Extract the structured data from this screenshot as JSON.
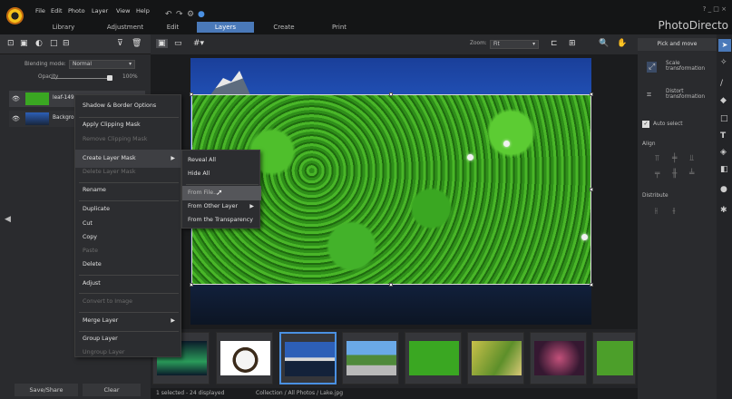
{
  "menubar": {
    "items": [
      "File",
      "Edit",
      "Photo",
      "Layer",
      "View",
      "Help"
    ],
    "undo_icons": [
      "↶",
      "↷",
      "⚙",
      "●"
    ],
    "window_controls": "? _ □ ×"
  },
  "tabs": [
    {
      "label": "Library"
    },
    {
      "label": "Adjustment"
    },
    {
      "label": "Edit"
    },
    {
      "label": "Layers"
    },
    {
      "label": "Create"
    },
    {
      "label": "Print"
    }
  ],
  "brand": "PhotoDirecto",
  "left_panel": {
    "blending_label": "Blending mode:",
    "blending_value": "Normal",
    "opacity_label": "Opacity",
    "opacity_value": "100%",
    "opacity": 1.0,
    "layers": [
      {
        "name": "leaf-14999"
      },
      {
        "name": "Background"
      }
    ],
    "save_share": "Save/Share",
    "clear": "Clear"
  },
  "canvas_toolbar": {
    "zoom_label": "Zoom:",
    "zoom_value": "Fit"
  },
  "context_menu": {
    "items": [
      {
        "label": "Shadow & Border Options",
        "enabled": true
      },
      {
        "label": "Apply Clipping Mask",
        "enabled": true
      },
      {
        "label": "Remove Clipping Mask",
        "enabled": false
      },
      {
        "label": "Create Layer Mask",
        "enabled": true,
        "submenu": true
      },
      {
        "label": "Delete Layer Mask",
        "enabled": false
      },
      {
        "label": "Rename",
        "enabled": true
      },
      {
        "label": "Duplicate",
        "enabled": true
      },
      {
        "label": "Cut",
        "enabled": true
      },
      {
        "label": "Copy",
        "enabled": true
      },
      {
        "label": "Paste",
        "enabled": false
      },
      {
        "label": "Delete",
        "enabled": true
      },
      {
        "label": "Adjust",
        "enabled": true
      },
      {
        "label": "Convert to Image",
        "enabled": false
      },
      {
        "label": "Merge Layer",
        "enabled": true,
        "submenu": true
      },
      {
        "label": "Group Layer",
        "enabled": true
      },
      {
        "label": "Ungroup Layer",
        "enabled": false
      }
    ]
  },
  "submenu": {
    "items": [
      {
        "label": "Reveal All"
      },
      {
        "label": "Hide All"
      },
      {
        "label": "From File..."
      },
      {
        "label": "From Other Layer"
      },
      {
        "label": "From the Transparency"
      }
    ]
  },
  "right_panel": {
    "title": "Pick and move",
    "scale": "Scale transformation",
    "distort": "Distort transformation",
    "auto_select": "Auto select",
    "align": "Align",
    "distribute": "Distribute"
  },
  "status": {
    "selection": "1 selected - 24 displayed",
    "path": "Collection / All Photos / Lake.jpg"
  },
  "colors": {
    "accent": "#4a79b9",
    "background": "#1e1f21",
    "panel": "#2a2b2e"
  }
}
